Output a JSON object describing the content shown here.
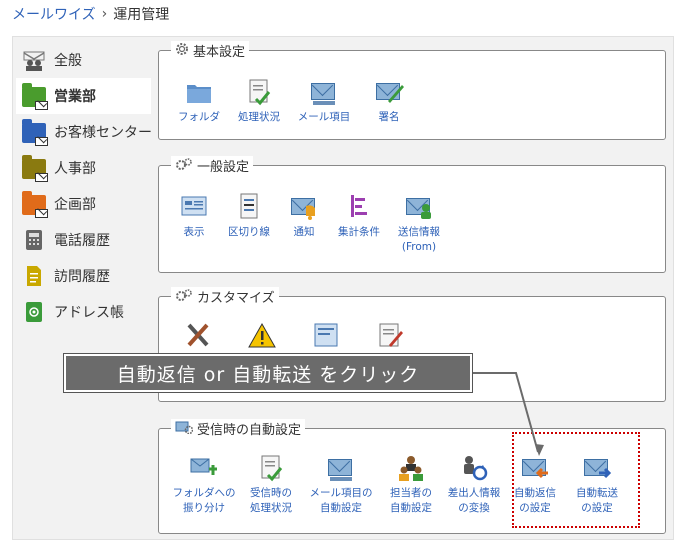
{
  "breadcrumb": {
    "root": "メールワイズ",
    "separator": "›",
    "current": "運用管理"
  },
  "sidebar": {
    "items": [
      {
        "label": "全般",
        "icon": "people-icon"
      },
      {
        "label": "営業部",
        "icon": "folder-mail-icon",
        "color": "#4a9c2d"
      },
      {
        "label": "お客様センター",
        "icon": "folder-mail-icon",
        "color": "#2f62b8"
      },
      {
        "label": "人事部",
        "icon": "folder-mail-icon",
        "color": "#8a7a10"
      },
      {
        "label": "企画部",
        "icon": "folder-mail-icon",
        "color": "#e06b1a"
      },
      {
        "label": "電話履歴",
        "icon": "phone-icon"
      },
      {
        "label": "訪問履歴",
        "icon": "document-icon"
      },
      {
        "label": "アドレス帳",
        "icon": "address-book-icon"
      }
    ]
  },
  "sections": {
    "basic": {
      "title": "基本設定",
      "items": [
        {
          "label": "フォルダ"
        },
        {
          "label": "処理状況"
        },
        {
          "label": "メール項目"
        },
        {
          "label": "署名"
        }
      ]
    },
    "general": {
      "title": "一般設定",
      "items": [
        {
          "label": "表示"
        },
        {
          "label": "区切り線"
        },
        {
          "label": "通知"
        },
        {
          "label": "集計条件"
        },
        {
          "label1": "送信情報",
          "label2": "(From)"
        }
      ]
    },
    "customize": {
      "title": "カスタマイズ"
    },
    "auto": {
      "title": "受信時の自動設定",
      "items": [
        {
          "label1": "フォルダへの",
          "label2": "振り分け"
        },
        {
          "label1": "受信時の",
          "label2": "処理状況"
        },
        {
          "label1": "メール項目の",
          "label2": "自動設定"
        },
        {
          "label1": "担当者の",
          "label2": "自動設定"
        },
        {
          "label1": "差出人情報",
          "label2": "の変換"
        },
        {
          "label1": "自動返信",
          "label2": "の設定"
        },
        {
          "label1": "自動転送",
          "label2": "の設定"
        }
      ]
    }
  },
  "callout": {
    "text": "自動返信 or 自動転送 をクリック"
  },
  "colors": {
    "link": "#2f62b8",
    "highlight": "#cc0000",
    "callout_bg": "#6b6b6b"
  }
}
